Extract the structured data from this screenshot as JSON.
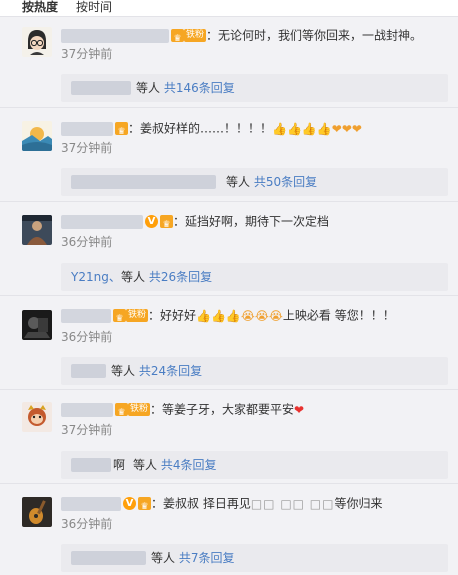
{
  "tabs": {
    "hot": "按热度",
    "time": "按时间"
  },
  "comments": [
    {
      "message": "：无论何时，我们等你回来，一战封神。",
      "emojis": "",
      "time": "37分钟前",
      "badge_fan": "铁粉",
      "replies": {
        "label": "等人",
        "count": "共146条回复"
      }
    },
    {
      "message": "：姜叔好样的……！！！！",
      "emojis": "👍👍👍👍❤❤❤",
      "time": "37分钟前",
      "replies": {
        "label": "等人",
        "count": "共50条回复"
      }
    },
    {
      "message": "：延挡好啊，期待下一次定档",
      "emojis": "",
      "time": "36分钟前",
      "replies": {
        "name": "Y21ng、",
        "label": "等人",
        "count": "共26条回复"
      }
    },
    {
      "message": "：好好好",
      "emojis": "👍👍👍😭😭😭",
      "message2": "上映必看 等您！！！",
      "time": "36分钟前",
      "badge_fan": "铁粉",
      "replies": {
        "label": "等人",
        "count": "共24条回复"
      }
    },
    {
      "message": "：等姜子牙，大家都要平安",
      "emojis": "❤",
      "time": "37分钟前",
      "badge_fan": "铁粉",
      "replies": {
        "name_suffix": "啊",
        "label": "等人",
        "count": "共4条回复"
      }
    },
    {
      "message": "：姜叔叔  择日再见",
      "message2": "等你归来",
      "time": "36分钟前",
      "replies": {
        "label": "等人",
        "count": "共7条回复"
      }
    }
  ],
  "colors": {
    "link": "#4a7dc3",
    "badge": "#f6a623",
    "heart": "#e8312f",
    "background": "#f2f2f5"
  },
  "icons": [
    "crown-badge-icon",
    "verified-v-icon",
    "thumbs-up-emoji",
    "crying-emoji",
    "heart-emoji"
  ]
}
